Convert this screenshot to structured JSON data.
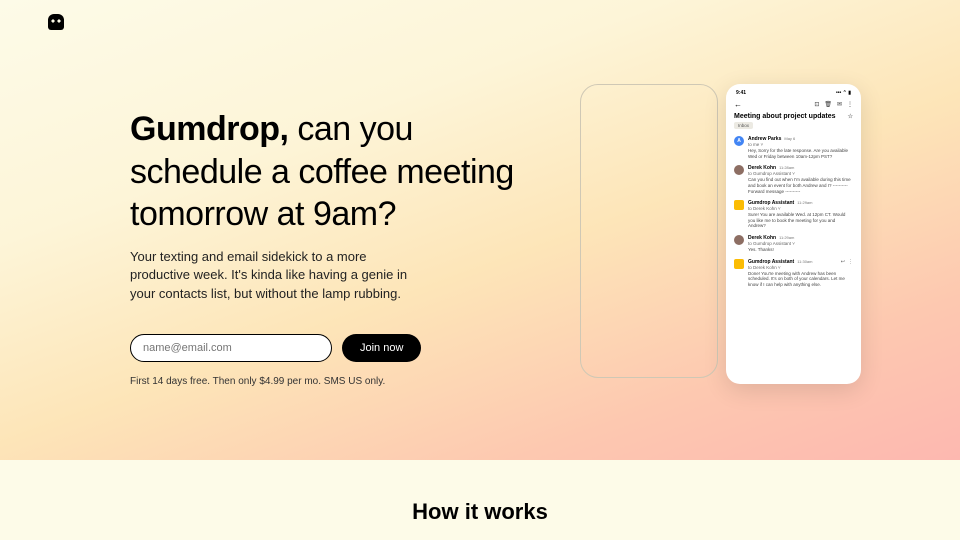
{
  "hero": {
    "brand": "Gumdrop,",
    "headline_rest": " can you schedule a coffee meeting tomorrow at 9am?",
    "subhead": "Your texting and email sidekick to a more productive week. It's kinda like having a genie in your contacts list, but without the lamp rubbing.",
    "email_placeholder": "name@email.com",
    "join_label": "Join now",
    "fineprint": "First 14 days free. Then only $4.99 per mo. SMS US only."
  },
  "phone": {
    "status_time": "9:41",
    "status_icons": "••• ⌃ ▮",
    "back": "←",
    "toolbar_icons": [
      "⊡",
      "🗑",
      "✉",
      "⋮"
    ],
    "thread_title": "Meeting about project updates",
    "star": "☆",
    "inbox_label": "Inbox",
    "messages": [
      {
        "avatar_class": "av-a",
        "avatar_text": "A",
        "name": "Andrew Parks",
        "time": "May 6",
        "to": "to me ˅",
        "body": "Hey, Sorry for the late response. Are you available Wed or Friday between 10am-12pm PST?",
        "reply": false,
        "dots": false
      },
      {
        "avatar_class": "av-d",
        "avatar_text": "",
        "name": "Derek Kohn",
        "time": "11:28am",
        "to": "to Gumdrop Assistant ˅",
        "body": "Can you find out when I'm available during this time and book an event for both Andrew and I? ---------- Forward message ----------",
        "reply": false,
        "dots": false
      },
      {
        "avatar_class": "av-g",
        "avatar_text": "",
        "name": "Gumdrop Assistant",
        "time": "11:29am",
        "to": "to Derek Kohn ˅",
        "body": "Sure! You are available Wed. at 12pm CT. Would you like me to book the meeting for you and Andrew?",
        "reply": false,
        "dots": false
      },
      {
        "avatar_class": "av-d",
        "avatar_text": "",
        "name": "Derek Kohn",
        "time": "11:29am",
        "to": "to Gumdrop Assistant ˅",
        "body": "Yes. Thanks!",
        "reply": false,
        "dots": false
      },
      {
        "avatar_class": "av-g",
        "avatar_text": "",
        "name": "Gumdrop Assistant",
        "time": "11:30am",
        "to": "to Derek Kohn ˅",
        "body": "Done! You're meeting with Andrew has been scheduled. It's on both of your calendars. Let me know if I can help with anything else.",
        "reply": true,
        "dots": true
      }
    ]
  },
  "section2": {
    "title": "How it works"
  }
}
